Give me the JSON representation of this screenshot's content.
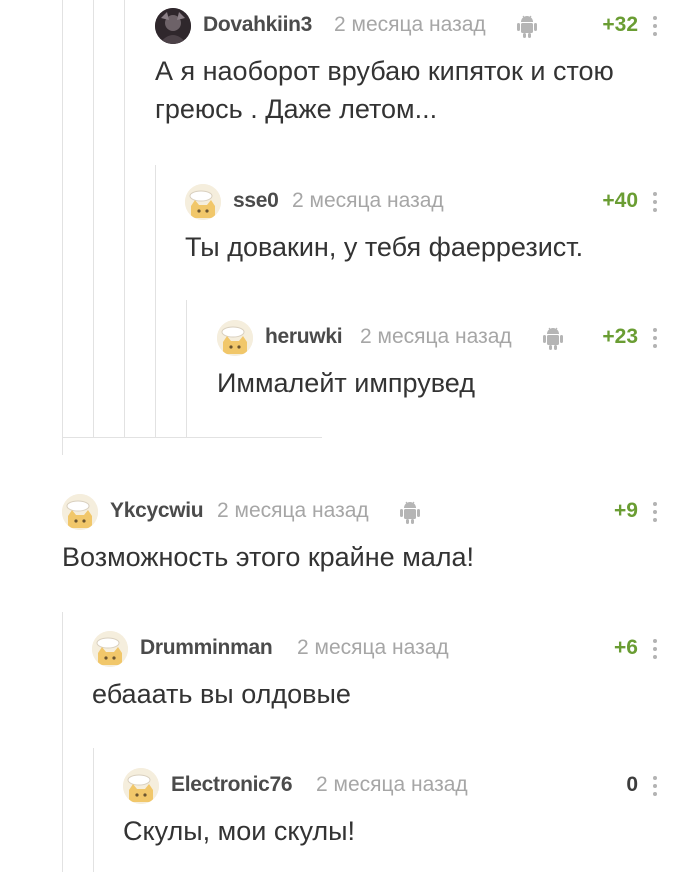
{
  "comments": [
    {
      "user": "Dovahkiin3",
      "time": "2 месяца назад",
      "rating": "+32",
      "avatar": "dark-photo-avatar",
      "platform": "android-icon",
      "text_lines": [
        "А я наоборот врубаю кипяток и стою",
        "греюсь . Даже летом..."
      ]
    },
    {
      "user": "sse0",
      "time": "2 месяца назад",
      "rating": "+40",
      "avatar": "default-cat-avatar",
      "text_lines": [
        "Ты довакин, у тебя фаеррезист."
      ]
    },
    {
      "user": "heruwki",
      "time": "2 месяца назад",
      "rating": "+23",
      "avatar": "default-cat-avatar",
      "platform": "android-icon",
      "text_lines": [
        "Иммалейт импрувед"
      ]
    },
    {
      "user": "Ykcycwiu",
      "time": "2 месяца назад",
      "rating": "+9",
      "avatar": "default-cat-avatar",
      "platform": "android-icon",
      "text_lines": [
        "Возможность этого крайне мала!"
      ]
    },
    {
      "user": "Drumminman",
      "time": "2 месяца назад",
      "rating": "+6",
      "avatar": "default-cat-avatar",
      "text_lines": [
        "ебааать вы олдовые"
      ]
    },
    {
      "user": "Electronic76",
      "time": "2 месяца назад",
      "rating": "0",
      "avatar": "default-cat-avatar",
      "text_lines": [
        "Скулы, мои скулы!"
      ]
    }
  ],
  "colors": {
    "rating_positive": "#6a9d33",
    "rating_zero": "#3d3d3d",
    "username": "#4b4b4b",
    "timestamp": "#a6a6a6",
    "body_text": "#333333",
    "thread_line": "#e2e2e2"
  }
}
